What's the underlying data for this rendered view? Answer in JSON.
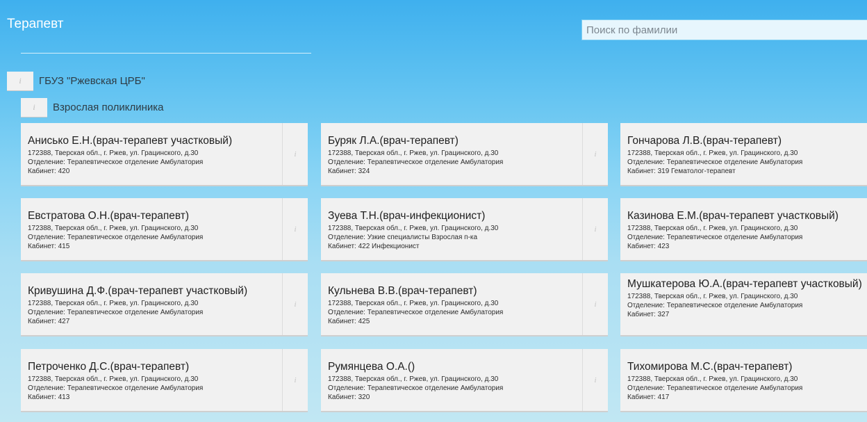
{
  "header": {
    "title": "Терапевт",
    "search_placeholder": "Поиск по фамилии"
  },
  "tree": {
    "organization": {
      "icon": "info-icon",
      "label": "ГБУЗ \"Ржевская ЦРБ\""
    },
    "department": {
      "icon": "info-icon",
      "label": "Взрослая поликлиника"
    }
  },
  "doctors": [
    {
      "name": "Анисько Е.Н.(врач-терапевт участковый)",
      "address": "172388, Тверская обл., г. Ржев, ул. Грацинского, д.30",
      "department": "Отделение: Терапевтическое отделение Амбулатория",
      "cabinet": "Кабинет: 420",
      "info_icon": "i"
    },
    {
      "name": "Буряк Л.А.(врач-терапевт)",
      "address": "172388, Тверская обл., г. Ржев, ул. Грацинского, д.30",
      "department": "Отделение: Терапевтическое отделение Амбулатория",
      "cabinet": "Кабинет: 324",
      "info_icon": "i"
    },
    {
      "name": "Гончарова Л.В.(врач-терапевт)",
      "address": "172388, Тверская обл., г. Ржев, ул. Грацинского, д.30",
      "department": "Отделение: Терапевтическое отделение Амбулатория",
      "cabinet": "Кабинет: 319 Гематолог-терапевт",
      "info_icon": "i"
    },
    {
      "name": "Евстратова О.Н.(врач-терапевт)",
      "address": "172388, Тверская обл., г. Ржев, ул. Грацинского, д.30",
      "department": "Отделение: Терапевтическое отделение Амбулатория",
      "cabinet": "Кабинет: 415",
      "info_icon": "i"
    },
    {
      "name": "Зуева Т.Н.(врач-инфекционист)",
      "address": "172388, Тверская обл., г. Ржев, ул. Грацинского, д.30",
      "department": "Отделение: Узкие специалисты Взрослая п-ка",
      "cabinet": "Кабинет: 422 Инфекционист",
      "info_icon": "i"
    },
    {
      "name": "Казинова Е.М.(врач-терапевт участковый)",
      "address": "172388, Тверская обл., г. Ржев, ул. Грацинского, д.30",
      "department": "Отделение: Терапевтическое отделение Амбулатория",
      "cabinet": "Кабинет: 423",
      "info_icon": "i"
    },
    {
      "name": "Кривушина Д.Ф.(врач-терапевт участковый)",
      "address": "172388, Тверская обл., г. Ржев, ул. Грацинского, д.30",
      "department": "Отделение: Терапевтическое отделение Амбулатория",
      "cabinet": "Кабинет: 427",
      "info_icon": "i"
    },
    {
      "name": "Кульнева В.В.(врач-терапевт)",
      "address": "172388, Тверская обл., г. Ржев, ул. Грацинского, д.30",
      "department": "Отделение: Терапевтическое отделение Амбулатория",
      "cabinet": "Кабинет: 425",
      "info_icon": "i"
    },
    {
      "name": "Мушкатерова Ю.А.(врач-терапевт участковый)",
      "address": "172388, Тверская обл., г. Ржев, ул. Грацинского, д.30",
      "department": "Отделение: Терапевтическое отделение Амбулатория",
      "cabinet": "Кабинет: 327",
      "info_icon": "i"
    },
    {
      "name": "Петроченко Д.С.(врач-терапевт)",
      "address": "172388, Тверская обл., г. Ржев, ул. Грацинского, д.30",
      "department": "Отделение: Терапевтическое отделение Амбулатория",
      "cabinet": "Кабинет: 413",
      "info_icon": "i"
    },
    {
      "name": "Румянцева О.А.()",
      "address": "172388, Тверская обл., г. Ржев, ул. Грацинского, д.30",
      "department": "Отделение: Терапевтическое отделение Амбулатория",
      "cabinet": "Кабинет: 320",
      "info_icon": "i"
    },
    {
      "name": "Тихомирова М.С.(врач-терапевт)",
      "address": "172388, Тверская обл., г. Ржев, ул. Грацинского, д.30",
      "department": "Отделение: Терапевтическое отделение Амбулатория",
      "cabinet": "Кабинет: 417",
      "info_icon": "i"
    }
  ]
}
